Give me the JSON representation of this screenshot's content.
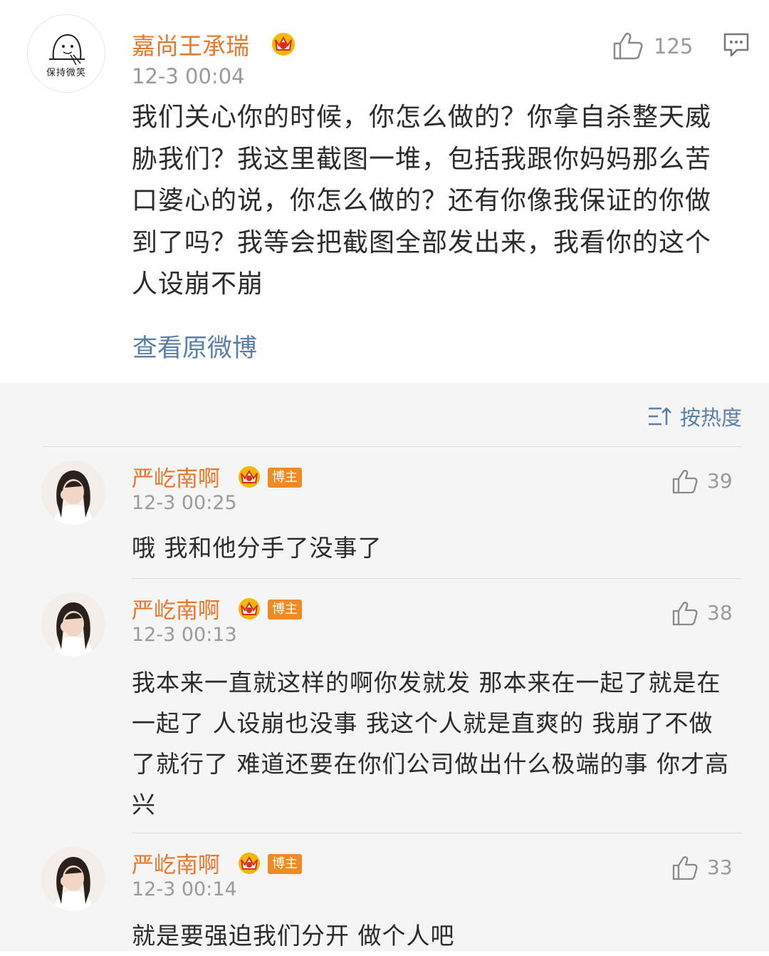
{
  "main_post": {
    "avatar_caption": "保持微笑",
    "username": "嘉尚王承瑞",
    "timestamp": "12-3 00:04",
    "like_count": "125",
    "text": "我们关心你的时候，你怎么做的？你拿自杀整天威胁我们？我这里截图一堆，包括我跟你妈妈那么苦口婆心的说，你怎么做的？还有你像我保证的你做到了吗？我等会把截图全部发出来，我看你的这个人设崩不崩",
    "view_original": "查看原微博"
  },
  "sort": {
    "label": "按热度"
  },
  "replies": [
    {
      "username": "严屹南啊",
      "badge": "博主",
      "timestamp": "12-3 00:25",
      "like_count": "39",
      "text": "哦 我和他分手了没事了"
    },
    {
      "username": "严屹南啊",
      "badge": "博主",
      "timestamp": "12-3 00:13",
      "like_count": "38",
      "text": "我本来一直就这样的啊你发就发 那本来在一起了就是在一起了 人设崩也没事 我这个人就是直爽的 我崩了不做了就行了 难道还要在你们公司做出什么极端的事 你才高兴"
    },
    {
      "username": "严屹南啊",
      "badge": "博主",
      "timestamp": "12-3 00:14",
      "like_count": "33",
      "text": "就是要强迫我们分开 做个人吧"
    }
  ],
  "icons": {
    "like": "thumbs-up-icon",
    "comment": "comment-icon",
    "crown": "vip-crown-icon",
    "sort": "sort-icon"
  },
  "colors": {
    "username": "#e8782b",
    "link": "#5b7ea6",
    "badge": "#f08a24",
    "meta": "#9a9a9a",
    "reply_bg": "#f5f5f5"
  }
}
